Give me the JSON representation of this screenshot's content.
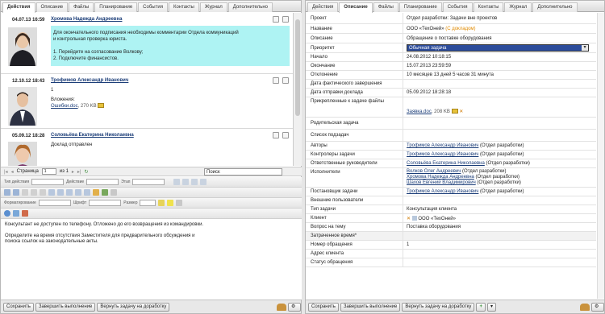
{
  "left": {
    "tabs": [
      "Действия",
      "Описание",
      "Файлы",
      "Планирование",
      "События",
      "Контакты",
      "Журнал",
      "Дополнительно"
    ],
    "entries": [
      {
        "date": "04.07.13 16:59",
        "author": "Хромова Надежда Андреевна",
        "lines": [
          "Для окончательного подписания необходимы комментарии Отдела коммуникаций",
          "и контрольная проверка юриста.",
          "",
          "1. Перейдите на согласование Волкову;",
          "2. Подключите финансистов."
        ]
      },
      {
        "date": "12.10.12 18:43",
        "author": "Трофимов Александр Иванович",
        "num": "1",
        "attach_label": "Вложения:",
        "attach_file": "Ошибки.doc",
        "attach_size": ", 270 KB"
      },
      {
        "date": "05.09.12 18:28",
        "author": "Соловьёва Екатерина Николаевна",
        "text": "Доклад отправлен"
      }
    ],
    "pager": {
      "page_label": "Страница",
      "page_value": "1",
      "of_label": "из 1",
      "search": "Поиск"
    },
    "toolbar1": {
      "type_label": "Тип действия",
      "action_label": "Действие",
      "section_label": "Этап"
    },
    "toolbar2": {
      "format_label": "Форматирование",
      "font_label": "Шрифт",
      "size_label": "Размер"
    },
    "editor_lines": [
      "Консультант не доступен по телефону. Отложено до его возвращения из командировки.",
      "",
      "Определите на время отсутствия Заместителя для предварительного обсуждения и",
      "поиска ссылок на законодательные акты."
    ],
    "buttons": [
      "Сохранить",
      "Завершить выполнение",
      "Вернуть задачу на доработку"
    ]
  },
  "right": {
    "tabs": [
      "Действия",
      "Описание",
      "Файлы",
      "Планирование",
      "События",
      "Контакты",
      "Журнал",
      "Дополнительно"
    ],
    "fields": [
      {
        "label": "Проект",
        "value": "Отдел разработки: Задачи вне проектов"
      },
      {
        "label": "Название",
        "value": "ООО «ТехОней»",
        "extra": "(С докладом)"
      },
      {
        "label": "Описание",
        "value": "Обращение о поставке оборудования"
      },
      {
        "label": "Приоритет",
        "value": "Обычная задача"
      },
      {
        "label": "Начало",
        "value": "24.08.2012 10:18:15"
      },
      {
        "label": "Окончание",
        "value": "15.07.2013 23:59:59"
      },
      {
        "label": "Отклонение",
        "value": "10 месяцев 13 дней 5 часов 31 минута"
      },
      {
        "label": "Дата фактического завершения",
        "value": ""
      },
      {
        "label": "Дата отправки доклада",
        "value": "05.09.2012 18:28:18"
      },
      {
        "label": "Прикрепленные к задаче файлы",
        "value": "Заявка.doc",
        "size": ", 208 KB"
      },
      {
        "label": "Родительская задача",
        "value": ""
      },
      {
        "label": "Список подзадач",
        "value": ""
      },
      {
        "label": "Авторы",
        "value": "Трофимов Александр Иванович",
        "extra": " (Отдел разработки)"
      },
      {
        "label": "Контролеры задачи",
        "value": "Трофимов Александр Иванович",
        "extra": " (Отдел разработки)"
      },
      {
        "label": "Ответственные руководители",
        "value": "Соловьёва Екатерина Николаевна",
        "extra": " (Отдел разработки)"
      },
      {
        "label": "Исполнители",
        "lines": [
          [
            "Волков Олег Андреевич",
            " (Отдел разработки)"
          ],
          [
            "Хромова Надежда Андреевна",
            " (Отдел разработки)"
          ],
          [
            "Шахов Евгений Владимирович",
            " (Отдел разработки)"
          ]
        ]
      },
      {
        "label": "Постановщик задачи",
        "value": "Трофимов Александр Иванович",
        "extra": " (Отдел разработки)"
      },
      {
        "label": "Внешние пользователи",
        "value": ""
      },
      {
        "label": "Тип задачи",
        "value": "Консультация клиента"
      },
      {
        "label": "Клиент",
        "value": "ООО «ТехОней»"
      },
      {
        "label": "Вопрос на тему",
        "value": "Поставка оборудования"
      },
      {
        "label": "Затраченное время*",
        "value": ""
      },
      {
        "label": "Номер обращения",
        "value": "1"
      },
      {
        "label": "Адрес клиента",
        "value": ""
      },
      {
        "label": "Статус обращения",
        "value": ""
      }
    ],
    "buttons": [
      "Сохранить",
      "Завершить выполнение",
      "Вернуть задачу на доработку"
    ]
  },
  "colors": {
    "highlight": "#aef3f3",
    "link": "#1b3d78",
    "priority_bg": "#2c4c9b",
    "pencil": "#e88a1f"
  }
}
